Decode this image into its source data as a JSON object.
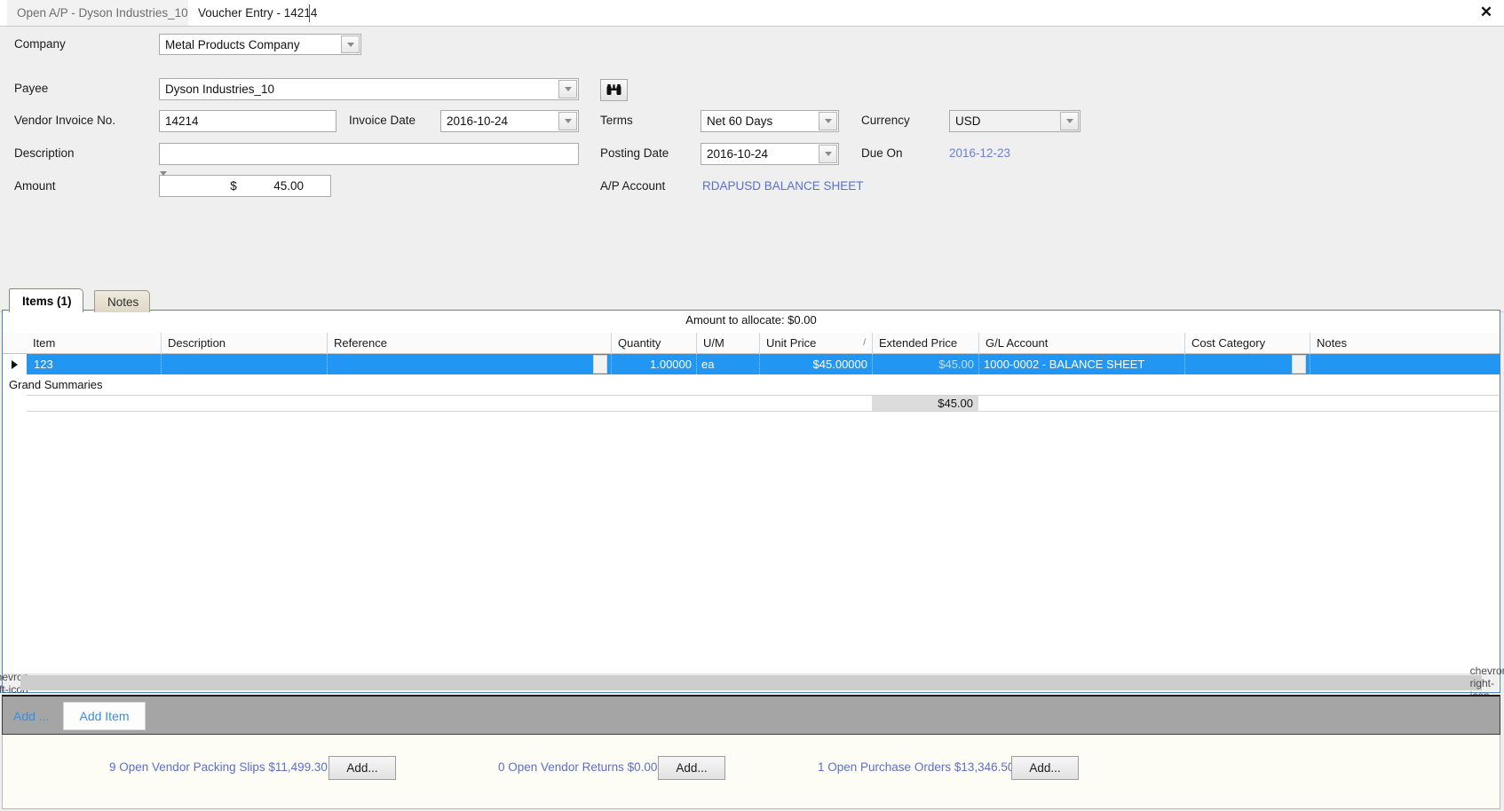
{
  "window": {
    "tabs": [
      {
        "label": "Open A/P - Dyson Industries_10",
        "active": false
      },
      {
        "label": "Voucher Entry - 14214",
        "active": true
      }
    ],
    "close_icon": "close-icon"
  },
  "form": {
    "company_label": "Company",
    "company_value": "Metal Products Company",
    "payee_label": "Payee",
    "payee_value": "Dyson Industries_10",
    "find_icon": "binoculars-icon",
    "vendor_invoice_label": "Vendor Invoice No.",
    "vendor_invoice_value": "14214",
    "invoice_date_label": "Invoice Date",
    "invoice_date_value": "2016-10-24",
    "description_label": "Description",
    "description_value": "",
    "amount_label": "Amount",
    "amount_currency_symbol": "$",
    "amount_value": "45.00",
    "terms_label": "Terms",
    "terms_value": "Net 60 Days",
    "currency_label": "Currency",
    "currency_value": "USD",
    "posting_date_label": "Posting Date",
    "posting_date_value": "2016-10-24",
    "due_on_label": "Due On",
    "due_on_value": "2016-12-23",
    "ap_account_label": "A/P Account",
    "ap_account_value": "RDAPUSD BALANCE SHEET",
    "collapse_icon": "chevron-down-icon"
  },
  "grid_tabs": [
    {
      "label": "Items (1)",
      "active": true
    },
    {
      "label": "Notes",
      "active": false
    }
  ],
  "grid": {
    "allocate_text": "Amount to allocate: $0.00",
    "columns": [
      "Item",
      "Description",
      "Reference",
      "Quantity",
      "U/M",
      "Unit Price",
      "Extended Price",
      "G/L Account",
      "Cost Category",
      "Notes"
    ],
    "sort_indicator": "/",
    "rows": [
      {
        "item": "123",
        "description": "",
        "reference": "",
        "quantity": "1.00000",
        "um": "ea",
        "unit_price": "$45.00000",
        "extended_price": "$45.00",
        "gl_account": "1000-0002 - BALANCE SHEET",
        "cost_category": "",
        "notes": ""
      }
    ],
    "grand_summaries_label": "Grand Summaries",
    "grand_summaries_total": "$45.00",
    "scroll_left_icon": "chevron-left-icon",
    "scroll_right_icon": "chevron-right-icon"
  },
  "addbar": {
    "add_link": "Add ...",
    "add_item_button": "Add Item"
  },
  "footer": {
    "groups": [
      {
        "text": "9 Open Vendor Packing Slips $11,499.30",
        "button": "Add..."
      },
      {
        "text": "0 Open Vendor Returns $0.00",
        "button": "Add..."
      },
      {
        "text": "1 Open Purchase Orders $13,346.50",
        "button": "Add..."
      }
    ]
  },
  "colors": {
    "selection_blue": "#2196f3",
    "link_blue": "#5b6fc9",
    "panel_border": "#4f81bd",
    "addbar_gray": "#a5a5a5"
  }
}
